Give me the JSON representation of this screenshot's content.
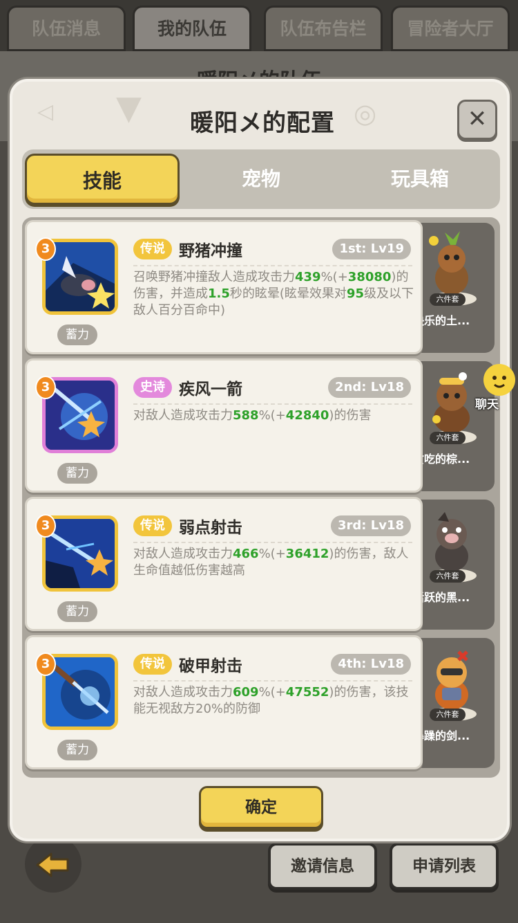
{
  "top_tabs": [
    {
      "label": "队伍消息",
      "active": false
    },
    {
      "label": "我的队伍",
      "active": true
    },
    {
      "label": "队伍布告栏",
      "active": false
    },
    {
      "label": "冒险者大厅",
      "active": false
    }
  ],
  "background_title": "暖阳メ的队伍",
  "bottom_buttons": {
    "invite": "邀请信息",
    "apply": "申请列表"
  },
  "modal": {
    "title": "暖阳メ的配置",
    "tabs": [
      {
        "label": "技能",
        "active": true
      },
      {
        "label": "宠物",
        "active": false
      },
      {
        "label": "玩具箱",
        "active": false
      }
    ],
    "confirm": "确定"
  },
  "skills": [
    {
      "level_badge": "3",
      "rarity": "传说",
      "name": "野猪冲撞",
      "slot": "1st: Lv19",
      "charge": "蓄力",
      "desc_html": "召唤野猪冲撞敌人造成攻击力<span class=\"g\">439</span>%(+<span class=\"g\">38080</span>)的伤害，并造成<span class=\"g\">1.5</span>秒的眩晕(眩晕效果对<span class=\"g\">95</span>级及以下敌人百分百命中)",
      "pet_tag": "六件套",
      "pet_name": "快乐的土..."
    },
    {
      "level_badge": "3",
      "rarity": "史诗",
      "name": "疾风一箭",
      "slot": "2nd: Lv18",
      "charge": "蓄力",
      "desc_html": "对敌人造成攻击力<span class=\"g\">588</span>%(+<span class=\"g\">42840</span>)的伤害",
      "pet_tag": "六件套",
      "pet_name": "贪吃的棕..."
    },
    {
      "level_badge": "3",
      "rarity": "传说",
      "name": "弱点射击",
      "slot": "3rd: Lv18",
      "charge": "蓄力",
      "desc_html": "对敌人造成攻击力<span class=\"g\">466</span>%(+<span class=\"g\">36412</span>)的伤害，敌人生命值越低伤害越高",
      "pet_tag": "六件套",
      "pet_name": "活跃的黑..."
    },
    {
      "level_badge": "3",
      "rarity": "传说",
      "name": "破甲射击",
      "slot": "4th: Lv18",
      "charge": "蓄力",
      "desc_html": "对敌人造成攻击力<span class=\"g\">609</span>%(+<span class=\"g\">47552</span>)的伤害，该技能无视敌方20%的防御",
      "pet_tag": "六件套",
      "pet_name": "暴躁的剑..."
    }
  ],
  "chat": {
    "label": "聊天"
  },
  "colors": {
    "accent_yellow": "#f3d458",
    "legend": "#f2c53c",
    "epic": "#e389dc",
    "value_green": "#2ea12a"
  }
}
